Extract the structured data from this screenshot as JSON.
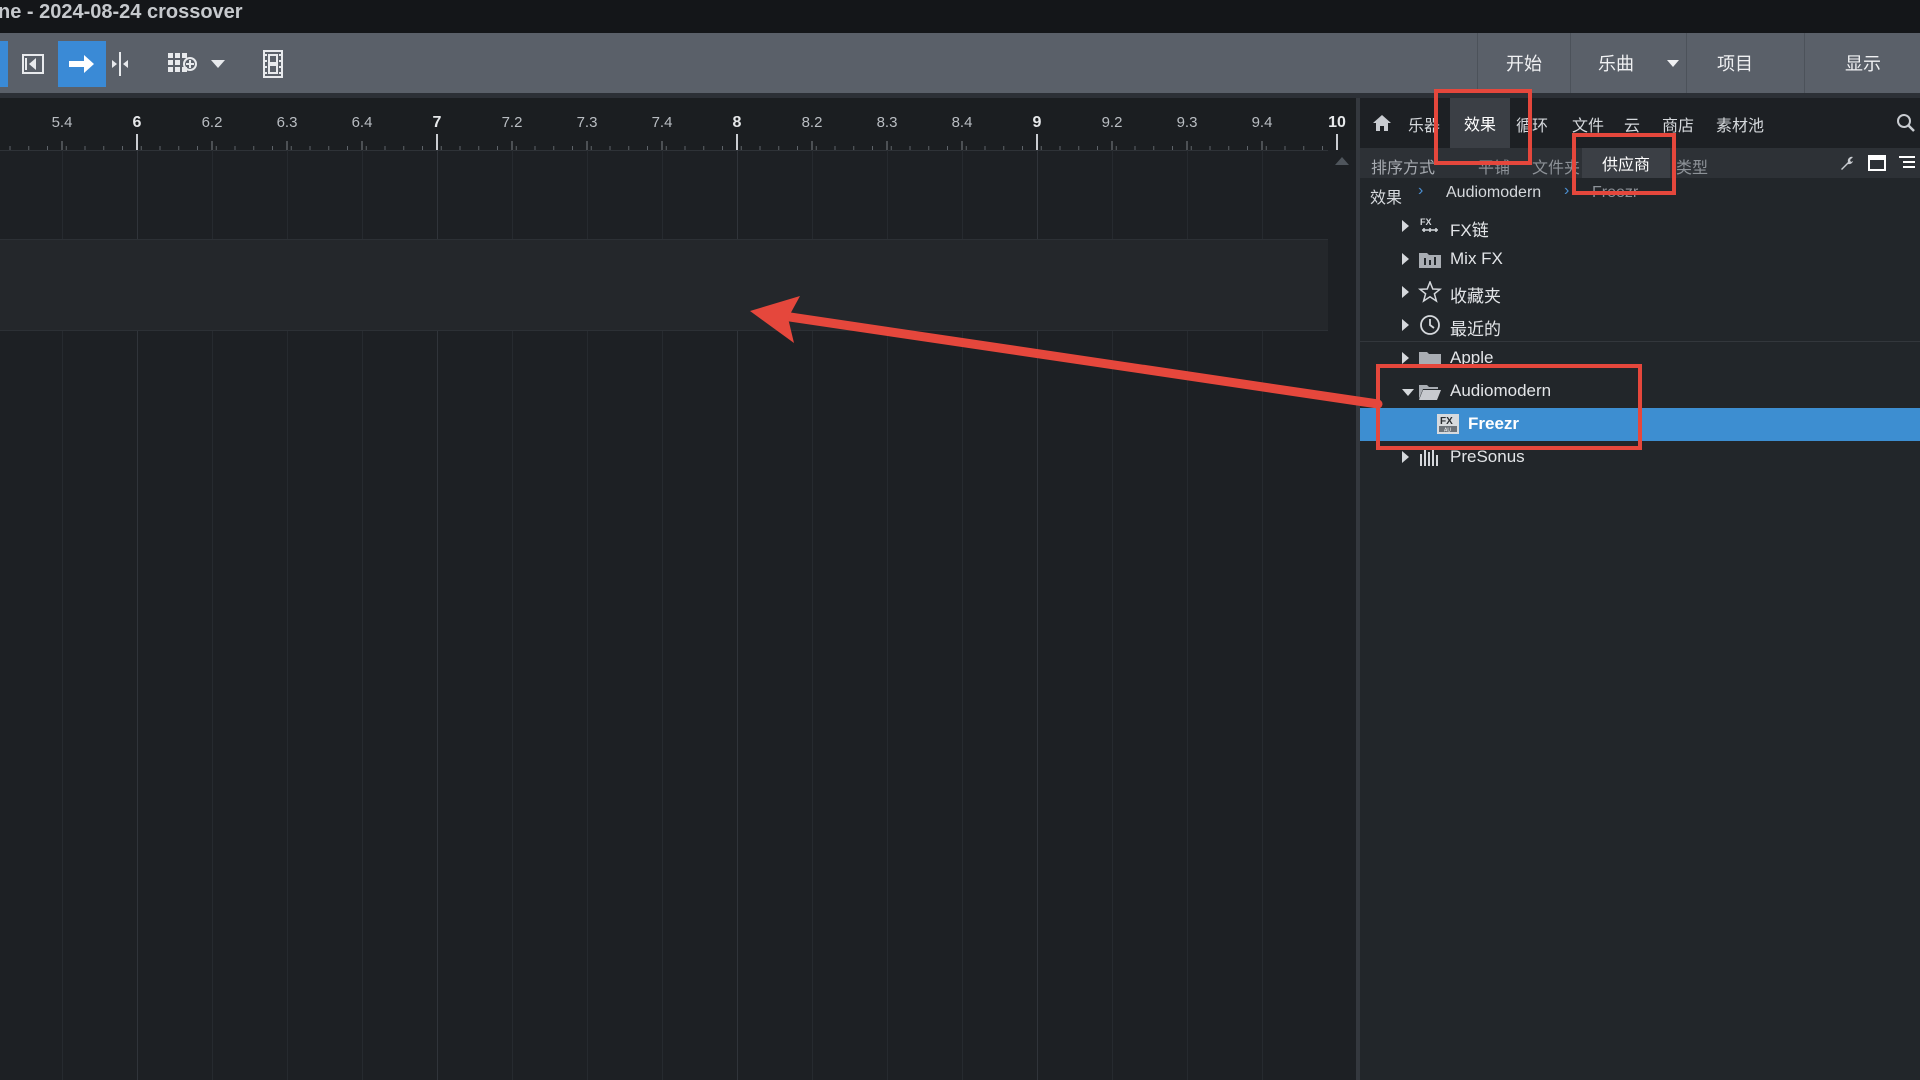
{
  "window": {
    "title": "ne - 2024-08-24 crossover"
  },
  "toolbar": {
    "tools": [
      {
        "name": "loop-back-icon"
      },
      {
        "name": "arrow-tool-icon",
        "active": true
      },
      {
        "name": "split-tool-icon"
      },
      {
        "name": "grid-snap-icon"
      },
      {
        "name": "dropdown-chevron-icon"
      },
      {
        "name": "video-icon"
      }
    ],
    "nav": {
      "start": "开始",
      "song": "乐曲",
      "project": "项目",
      "show": "显示"
    }
  },
  "ruler": {
    "ticks": [
      "5.4",
      "6",
      "6.2",
      "6.3",
      "6.4",
      "7",
      "7.2",
      "7.3",
      "7.4",
      "8",
      "8.2",
      "8.3",
      "8.4",
      "9",
      "9.2",
      "9.3",
      "9.4",
      "10"
    ],
    "major": [
      "6",
      "7",
      "8",
      "9",
      "10"
    ]
  },
  "browser": {
    "tabs": {
      "home_icon": "home-icon",
      "instruments": "乐器",
      "effects": "效果",
      "loops": "循环",
      "files": "文件",
      "cloud": "云",
      "shop": "商店",
      "pool": "素材池",
      "search_icon": "search-icon"
    },
    "sort": {
      "label": "排序方式",
      "flat": "平铺",
      "folder": "文件夹",
      "vendor": "供应商",
      "type": "类型"
    },
    "breadcrumb": {
      "root": "效果",
      "vendor": "Audiomodern",
      "plugin": "Freezr"
    },
    "tree": [
      {
        "label": "FX链",
        "icon": "fx-chain-icon",
        "expanded": false
      },
      {
        "label": "Mix FX",
        "icon": "mix-fx-icon",
        "expanded": false
      },
      {
        "label": "收藏夹",
        "icon": "star-icon",
        "expanded": false
      },
      {
        "label": "最近的",
        "icon": "clock-icon",
        "expanded": false
      },
      {
        "label": "Apple",
        "icon": "folder-icon",
        "expanded": false
      },
      {
        "label": "Audiomodern",
        "icon": "folder-open-icon",
        "expanded": true
      },
      {
        "label": "Freezr",
        "icon": "fx-au-plugin-icon",
        "selected": true
      },
      {
        "label": "PreSonus",
        "icon": "presonus-icon",
        "expanded": false
      }
    ]
  },
  "annotation": {
    "color": "#e5473c",
    "arrow": "drag-arrow"
  }
}
